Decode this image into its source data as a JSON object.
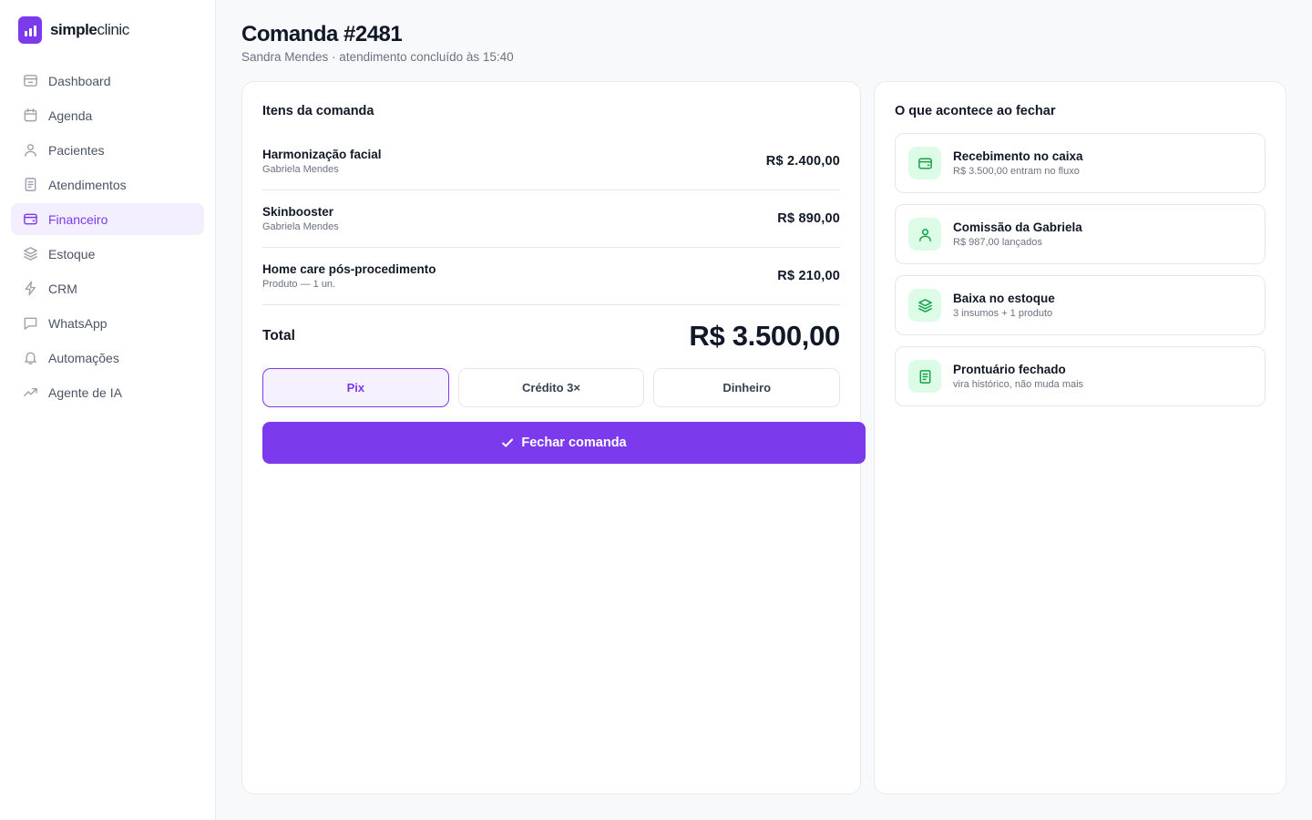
{
  "brand": {
    "name_bold": "simple",
    "name_light": "clinic"
  },
  "sidebar": {
    "items": [
      {
        "label": "Dashboard",
        "icon": "dashboard-icon"
      },
      {
        "label": "Agenda",
        "icon": "calendar-icon"
      },
      {
        "label": "Pacientes",
        "icon": "user-icon"
      },
      {
        "label": "Atendimentos",
        "icon": "document-icon"
      },
      {
        "label": "Financeiro",
        "icon": "wallet-icon",
        "active": true
      },
      {
        "label": "Estoque",
        "icon": "layers-icon"
      },
      {
        "label": "CRM",
        "icon": "bolt-icon"
      },
      {
        "label": "WhatsApp",
        "icon": "chat-icon"
      },
      {
        "label": "Automações",
        "icon": "bell-icon"
      },
      {
        "label": "Agente de IA",
        "icon": "trending-icon"
      }
    ]
  },
  "header": {
    "title": "Comanda #2481",
    "subtitle": "Sandra Mendes · atendimento concluído às 15:40"
  },
  "order": {
    "heading": "Itens da comanda",
    "items": [
      {
        "name": "Harmonização facial",
        "sub": "Gabriela Mendes",
        "price": "R$ 2.400,00"
      },
      {
        "name": "Skinbooster",
        "sub": "Gabriela Mendes",
        "price": "R$ 890,00"
      },
      {
        "name": "Home care pós-procedimento",
        "sub": "Produto — 1 un.",
        "price": "R$ 210,00"
      }
    ],
    "total_label": "Total",
    "total_value": "R$ 3.500,00",
    "payment_methods": [
      {
        "label": "Pix",
        "selected": true
      },
      {
        "label": "Crédito 3×",
        "selected": false
      },
      {
        "label": "Dinheiro",
        "selected": false
      }
    ],
    "close_label": "Fechar comanda"
  },
  "effects": {
    "heading": "O que acontece ao fechar",
    "items": [
      {
        "title": "Recebimento no caixa",
        "sub": "R$ 3.500,00 entram no fluxo",
        "icon": "wallet-icon"
      },
      {
        "title": "Comissão da Gabriela",
        "sub": "R$ 987,00 lançados",
        "icon": "user-icon"
      },
      {
        "title": "Baixa no estoque",
        "sub": "3 insumos + 1 produto",
        "icon": "layers-icon"
      },
      {
        "title": "Prontuário fechado",
        "sub": "vira histórico, não muda mais",
        "icon": "document-icon"
      }
    ]
  },
  "colors": {
    "accent": "#7c3aed",
    "accent_soft": "#f3efff",
    "success": "#16a34a",
    "success_soft": "#dcfce7"
  }
}
